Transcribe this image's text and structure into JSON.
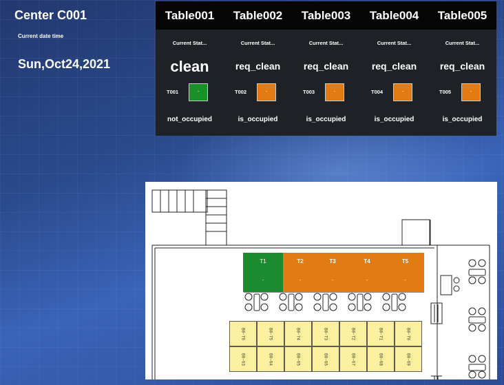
{
  "center": {
    "title": "Center C001",
    "date_label": "Current date time",
    "date_value": "Sun,Oct24,2021"
  },
  "tables": [
    {
      "title": "Table001",
      "sub": "Current Stat...",
      "status": "clean",
      "id": "T001",
      "swatch": "#179128",
      "occupancy": "not_occupied"
    },
    {
      "title": "Table002",
      "sub": "Current Stat...",
      "status": "req_clean",
      "id": "T002",
      "swatch": "#e27b11",
      "occupancy": "is_occupied"
    },
    {
      "title": "Table003",
      "sub": "Current Stat...",
      "status": "req_clean",
      "id": "T003",
      "swatch": "#e27b11",
      "occupancy": "is_occupied"
    },
    {
      "title": "Table004",
      "sub": "Current Stat...",
      "status": "req_clean",
      "id": "T004",
      "swatch": "#e27b11",
      "occupancy": "is_occupied"
    },
    {
      "title": "Table005",
      "sub": "Current Stat...",
      "status": "req_clean",
      "id": "T005",
      "swatch": "#e27b11",
      "occupancy": "is_occupied"
    }
  ],
  "floorplan": {
    "tables": [
      {
        "label": "T1",
        "color": "#1c8a2e"
      },
      {
        "label": "T2",
        "color": "#e27b11"
      },
      {
        "label": "T3",
        "color": "#e27b11"
      },
      {
        "label": "T4",
        "color": "#e27b11"
      },
      {
        "label": "T5",
        "color": "#e27b11"
      }
    ],
    "swatch_mark": "-",
    "seats_top": [
      "B0-76",
      "B0-75",
      "B0-74",
      "B0-73",
      "B0-72",
      "B0-71",
      "B0-70"
    ],
    "seats_bottom": [
      "B0-63",
      "B0-64",
      "B0-65",
      "B0-66",
      "B0-67",
      "B0-68",
      "B0-69"
    ]
  }
}
